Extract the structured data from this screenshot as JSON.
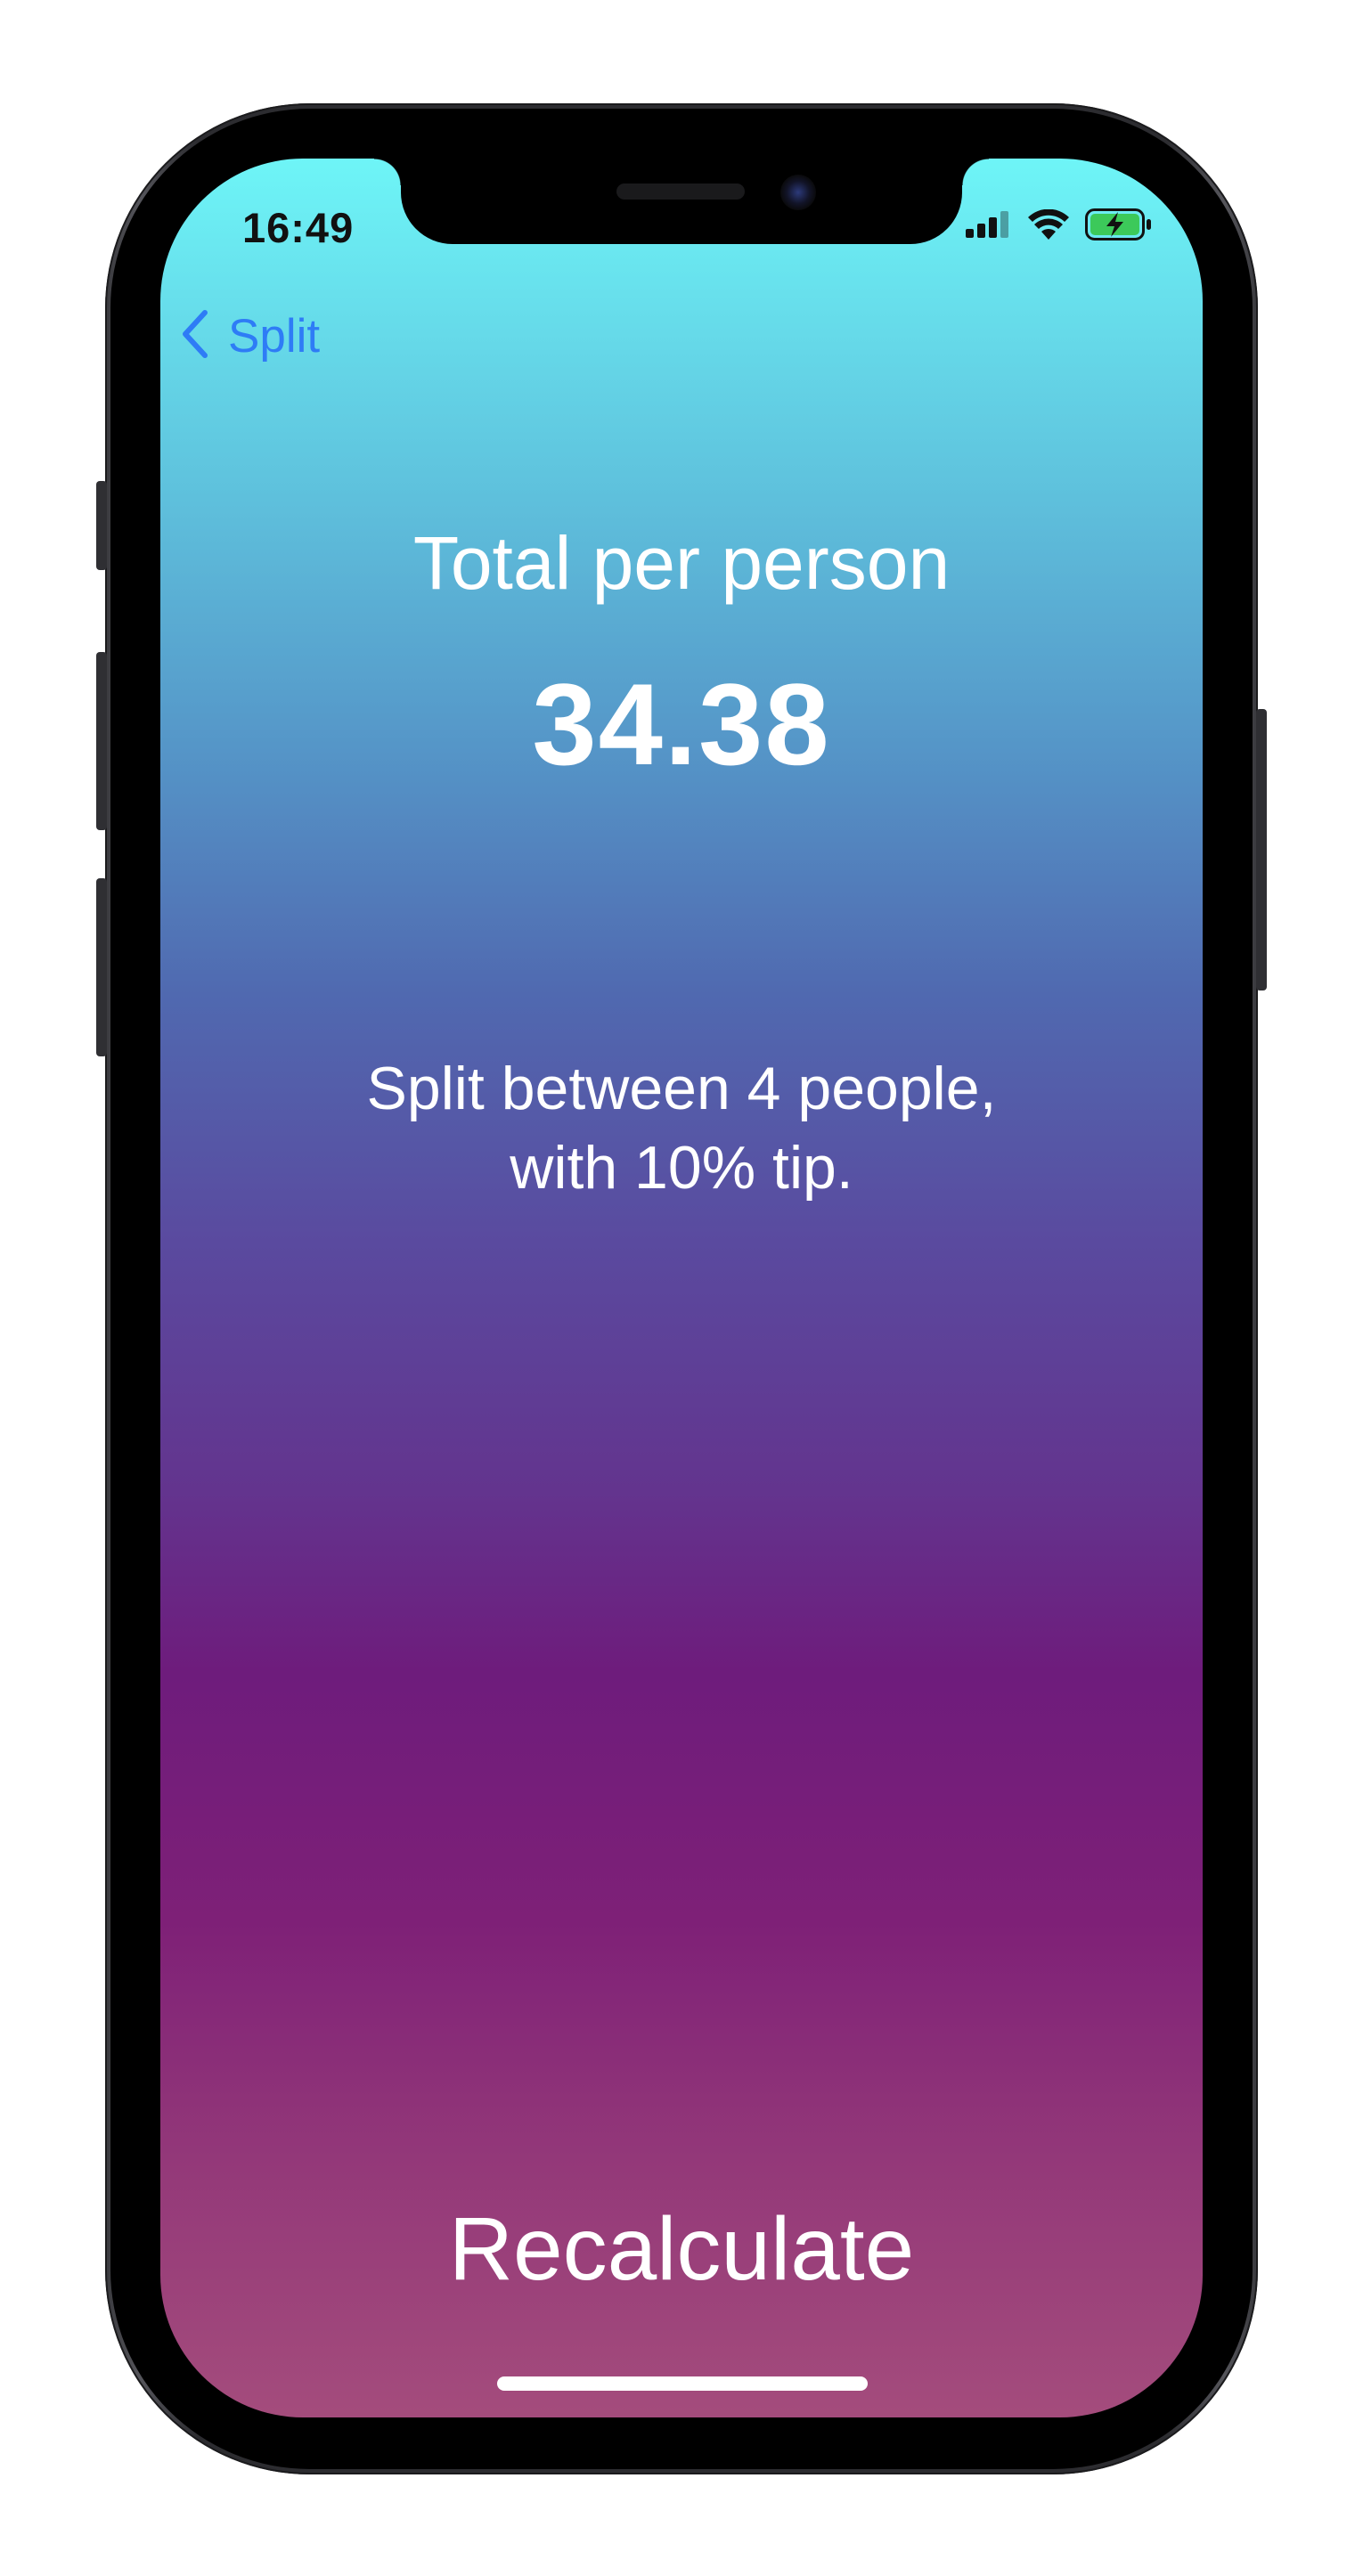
{
  "status_bar": {
    "time": "16:49",
    "icons": [
      "cellular-signal-icon",
      "wifi-icon",
      "battery-charging-icon"
    ]
  },
  "nav": {
    "back_label": "Split",
    "accent_color": "#2e7cf6"
  },
  "result": {
    "title": "Total per person",
    "amount": "34.38",
    "summary_line1": "Split between 4 people,",
    "summary_line2": "with 10% tip."
  },
  "actions": {
    "recalculate_label": "Recalculate"
  },
  "theme": {
    "gradient_top": "#6ef5f7",
    "gradient_middle": "#6e1c7c",
    "gradient_bottom": "#a44c7c",
    "text_color": "#ffffff"
  }
}
